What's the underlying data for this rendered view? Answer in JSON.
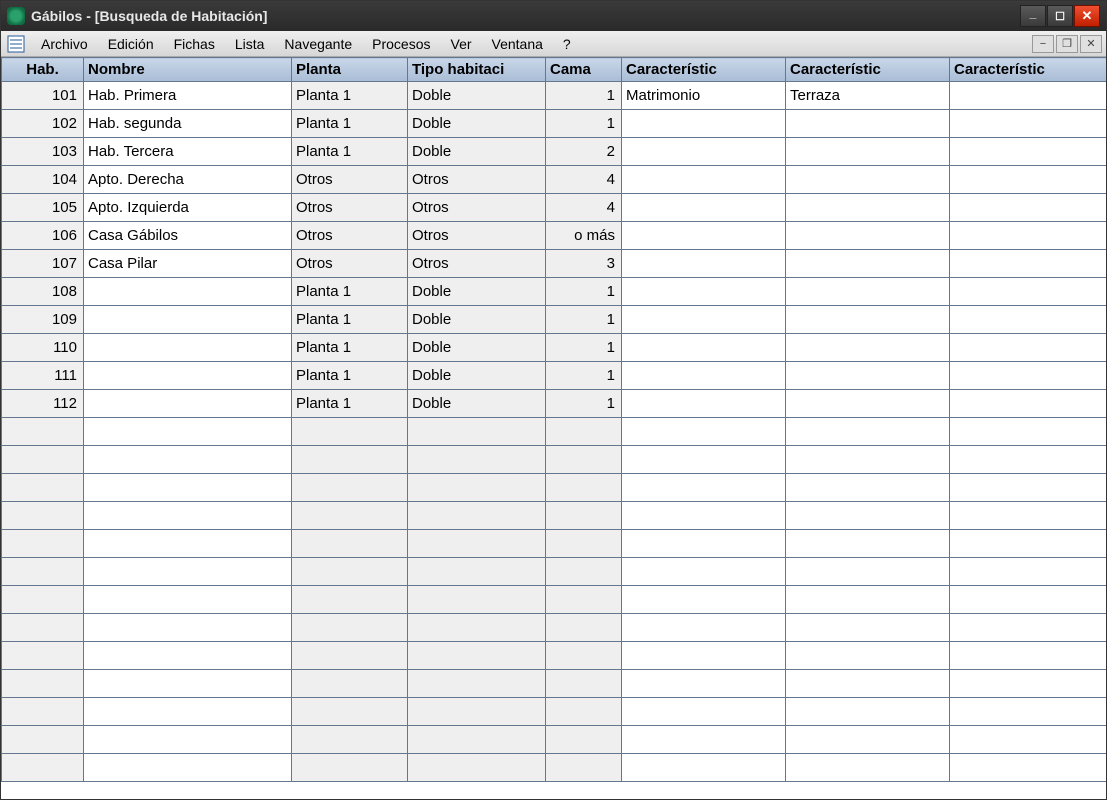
{
  "window": {
    "title": "Gábilos   - [Busqueda de Habitación]"
  },
  "menu": {
    "items": [
      "Archivo",
      "Edición",
      "Fichas",
      "Lista",
      "Navegante",
      "Procesos",
      "Ver",
      "Ventana",
      "?"
    ]
  },
  "table": {
    "columns": [
      "Hab.",
      "Nombre",
      "Planta",
      "Tipo habitaci",
      "Cama",
      "Característic",
      "Característic",
      "Característic"
    ],
    "rows": [
      {
        "hab": "101",
        "nombre": "Hab. Primera",
        "planta": "Planta 1",
        "tipo": "Doble",
        "cama": "1",
        "c1": "Matrimonio",
        "c2": "Terraza",
        "c3": "",
        "selected": true
      },
      {
        "hab": "102",
        "nombre": "Hab. segunda",
        "planta": "Planta 1",
        "tipo": "Doble",
        "cama": "1",
        "c1": "",
        "c2": "",
        "c3": ""
      },
      {
        "hab": "103",
        "nombre": "Hab. Tercera",
        "planta": "Planta 1",
        "tipo": "Doble",
        "cama": "2",
        "c1": "",
        "c2": "",
        "c3": ""
      },
      {
        "hab": "104",
        "nombre": "Apto. Derecha",
        "planta": "Otros",
        "tipo": "Otros",
        "cama": "4",
        "c1": "",
        "c2": "",
        "c3": ""
      },
      {
        "hab": "105",
        "nombre": "Apto. Izquierda",
        "planta": "Otros",
        "tipo": "Otros",
        "cama": "4",
        "c1": "",
        "c2": "",
        "c3": ""
      },
      {
        "hab": "106",
        "nombre": "Casa Gábilos",
        "planta": "Otros",
        "tipo": "Otros",
        "cama": "o más",
        "c1": "",
        "c2": "",
        "c3": ""
      },
      {
        "hab": "107",
        "nombre": "Casa Pilar",
        "planta": "Otros",
        "tipo": "Otros",
        "cama": "3",
        "c1": "",
        "c2": "",
        "c3": ""
      },
      {
        "hab": "108",
        "nombre": "",
        "planta": "Planta 1",
        "tipo": "Doble",
        "cama": "1",
        "c1": "",
        "c2": "",
        "c3": ""
      },
      {
        "hab": "109",
        "nombre": "",
        "planta": "Planta 1",
        "tipo": "Doble",
        "cama": "1",
        "c1": "",
        "c2": "",
        "c3": ""
      },
      {
        "hab": "110",
        "nombre": "",
        "planta": "Planta 1",
        "tipo": "Doble",
        "cama": "1",
        "c1": "",
        "c2": "",
        "c3": ""
      },
      {
        "hab": "111",
        "nombre": "",
        "planta": "Planta 1",
        "tipo": "Doble",
        "cama": "1",
        "c1": "",
        "c2": "",
        "c3": ""
      },
      {
        "hab": "112",
        "nombre": "",
        "planta": "Planta 1",
        "tipo": "Doble",
        "cama": "1",
        "c1": "",
        "c2": "",
        "c3": ""
      }
    ],
    "empty_rows": 13
  }
}
